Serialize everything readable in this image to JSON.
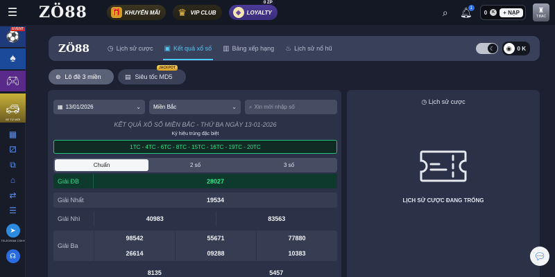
{
  "topbar": {
    "brand": "ZÖ88",
    "promos": [
      {
        "label": "KHUYẾN MÃI",
        "icon": "gift-box-icon"
      },
      {
        "label": "VIP CLUB",
        "icon": "crown-icon"
      },
      {
        "label": "LOYALTY",
        "icon": "diamond-icon",
        "badge": "0 ZP"
      }
    ],
    "notification_count": "1",
    "wallet_amount": "0",
    "deposit_label": "NẠP",
    "avatar_caption": "T.BẠC"
  },
  "sidebar": {
    "event_badge": "EVENT",
    "car_caption": "XE TỪ MỚI",
    "telegram_label": "TELEGRAM CSKH"
  },
  "subnav": {
    "logo": "ZÖ88",
    "tabs": [
      {
        "label": "Lịch sử cược",
        "active": false
      },
      {
        "label": "Kết quả xổ số",
        "active": true
      },
      {
        "label": "Bảng xếp hạng",
        "active": false
      },
      {
        "label": "Lịch sử nổ hũ",
        "active": false
      }
    ],
    "balance": "0 K"
  },
  "modes_top": {
    "lode_label": "Lô đề 3 miền",
    "sieutoc_label": "Siêu tốc MD5",
    "jackpot_badge": "JACKPOT"
  },
  "filters": {
    "date": "13/01/2026",
    "region": "Miền Bắc",
    "search_placeholder": "Xin mời nhập số"
  },
  "results": {
    "heading": "KẾT QUẢ XỔ SỐ MIỀN BẮC - THỨ BA NGÀY 13-01-2026",
    "special_codes_label": "Ký hiệu trúng đặc biệt",
    "special_codes": "1TC - 4TC - 6TC - 8TC - 15TC - 16TC - 19TC - 20TC",
    "view_modes": [
      "Chuẩn",
      "2 số",
      "3 số"
    ],
    "prizes": {
      "db": {
        "label": "Giải ĐB",
        "values": [
          "28027"
        ]
      },
      "nhat": {
        "label": "Giải Nhất",
        "values": [
          "19534"
        ]
      },
      "nhi": {
        "label": "Giải Nhì",
        "values": [
          "40983",
          "83563"
        ]
      },
      "ba": {
        "label": "Giải Ba",
        "values": [
          "98542",
          "55671",
          "77880",
          "26614",
          "09288",
          "10383"
        ]
      },
      "tu": {
        "values": [
          "8135",
          "5457"
        ]
      }
    }
  },
  "history": {
    "title": "Lịch sử cược",
    "empty_text": "LỊCH SỬ CƯỢC ĐANG TRỐNG"
  }
}
